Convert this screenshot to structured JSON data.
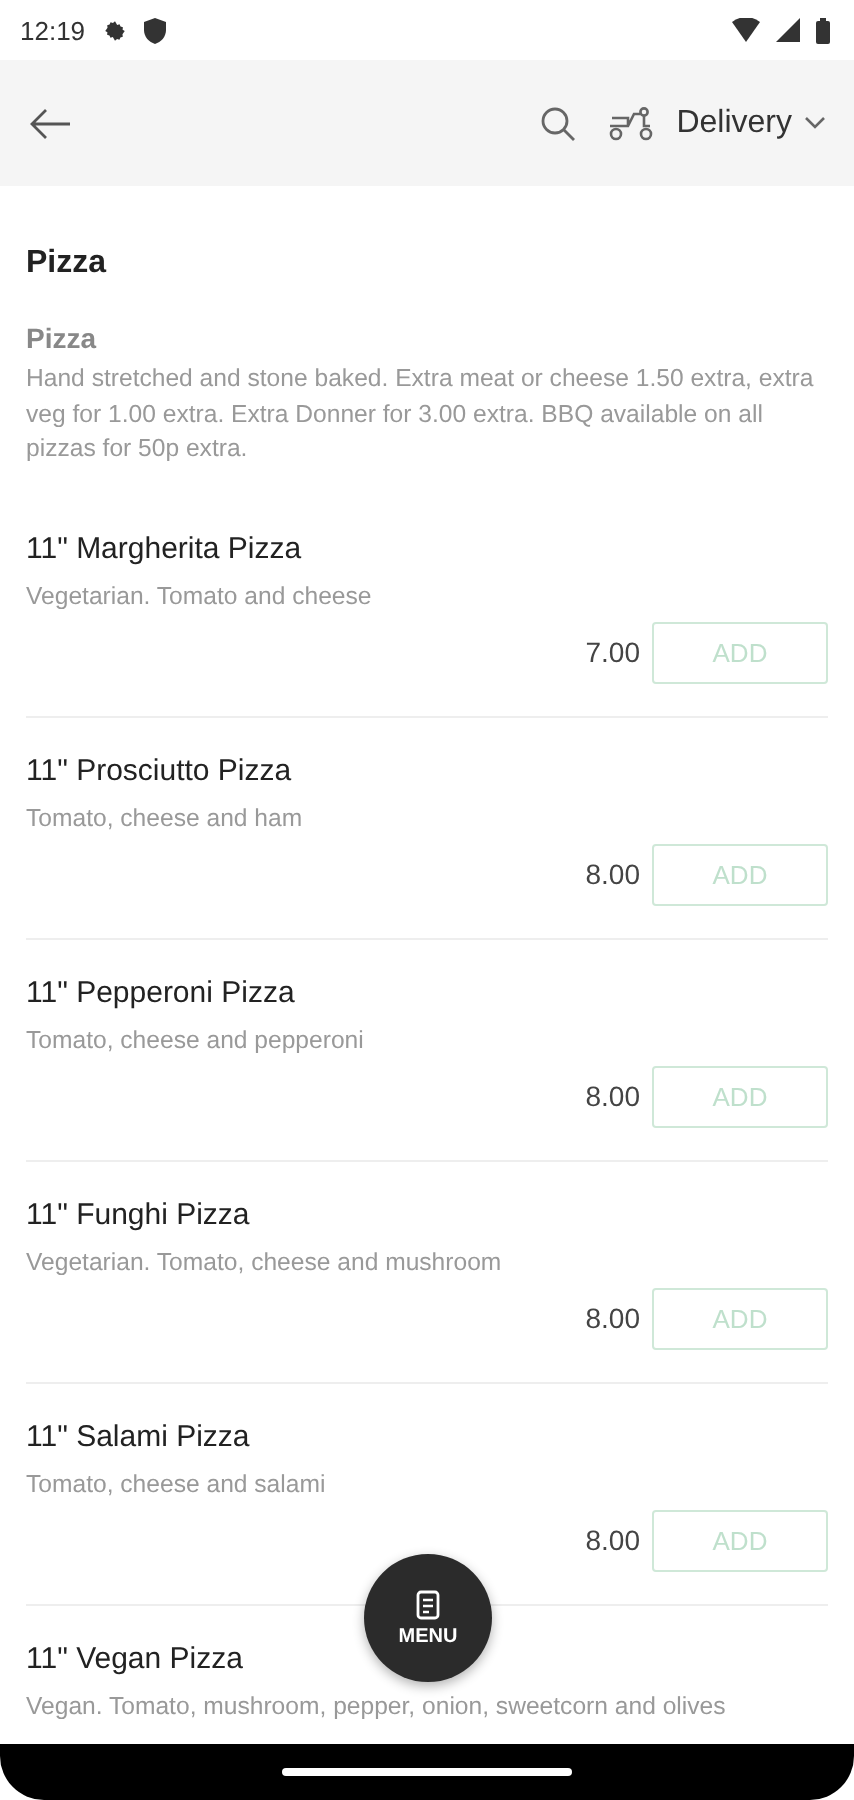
{
  "status_bar": {
    "time": "12:19"
  },
  "header": {
    "delivery_mode": "Delivery"
  },
  "section": {
    "title": "Pizza",
    "subtitle": "Pizza",
    "description": "Hand stretched and stone baked. Extra meat or cheese 1.50 extra, extra veg for 1.00 extra. Extra Donner for 3.00 extra. BBQ available on all pizzas for 50p extra."
  },
  "items": [
    {
      "name": "11\" Margherita Pizza",
      "description": "Vegetarian. Tomato and cheese",
      "price": "7.00",
      "button": "ADD"
    },
    {
      "name": "11\" Prosciutto Pizza",
      "description": "Tomato, cheese and ham",
      "price": "8.00",
      "button": "ADD"
    },
    {
      "name": "11\" Pepperoni Pizza",
      "description": "Tomato, cheese and pepperoni",
      "price": "8.00",
      "button": "ADD"
    },
    {
      "name": "11\" Funghi Pizza",
      "description": "Vegetarian. Tomato, cheese and mushroom",
      "price": "8.00",
      "button": "ADD"
    },
    {
      "name": "11\" Salami Pizza",
      "description": "Tomato, cheese and salami",
      "price": "8.00",
      "button": "ADD"
    },
    {
      "name": "11\" Vegan Pizza",
      "description": "Vegan. Tomato, mushroom, pepper, onion, sweetcorn and olives"
    }
  ],
  "fab": {
    "label": "MENU"
  }
}
